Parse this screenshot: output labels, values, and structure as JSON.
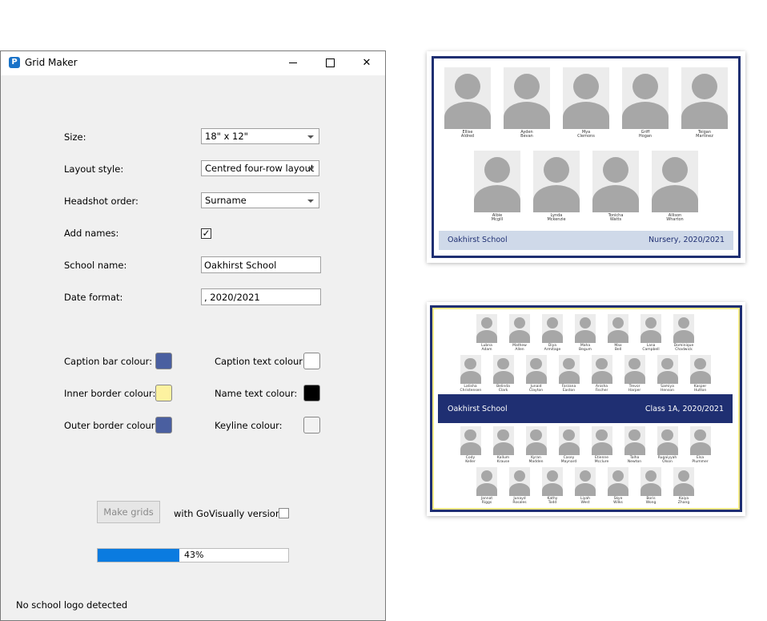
{
  "window": {
    "title": "Grid Maker",
    "app_icon": "P",
    "controls": {
      "minimize": "minimize-icon",
      "maximize": "maximize-icon",
      "close": "close-icon"
    }
  },
  "form": {
    "size_label": "Size:",
    "size_value": "18\" x 12\"",
    "layout_label": "Layout style:",
    "layout_value": "Centred four-row layout",
    "order_label": "Headshot order:",
    "order_value": "Surname",
    "names_label": "Add names:",
    "names_checked": true,
    "school_label": "School name:",
    "school_value": "Oakhirst School",
    "date_label": "Date format:",
    "date_value": ", 2020/2021",
    "check_mark": "✓"
  },
  "colours": {
    "caption_bar_label": "Caption bar colour:",
    "caption_bar": "#4a5fa0",
    "caption_text_label": "Caption text colour:",
    "caption_text": "#ffffff",
    "inner_border_label": "Inner border colour:",
    "inner_border": "#fdf2a0",
    "name_text_label": "Name text colour:",
    "name_text": "#000000",
    "outer_border_label": "Outer border colour:",
    "outer_border": "#4a5fa0",
    "keyline_label": "Keyline colour:",
    "keyline": "#f2f2f2"
  },
  "actions": {
    "make_grids": "Make grids",
    "govisually_label": "with GoVisually versions:",
    "govisually_checked": false,
    "progress": 0.43,
    "progress_text": "43%"
  },
  "status": {
    "text": "No school logo detected"
  },
  "preview1": {
    "school": "Oakhirst School",
    "class": "Nursery, 2020/2021",
    "rows": [
      [
        [
          "Ellise",
          "Aldred"
        ],
        [
          "Ayden",
          "Bevan"
        ],
        [
          "Mya",
          "Clemons"
        ],
        [
          "Griff",
          "Hogan"
        ],
        [
          "Teigan",
          "Martinez"
        ]
      ],
      [
        [
          "Albie",
          "Mcgill"
        ],
        [
          "Lynda",
          "Mckenzie"
        ],
        [
          "Tonicha",
          "Watts"
        ],
        [
          "Allison",
          "Wharton"
        ]
      ]
    ]
  },
  "preview2": {
    "school": "Oakhirst School",
    "class": "Class 1A, 2020/2021",
    "top_rows": [
      [
        [
          "Lubna",
          "Adam"
        ],
        [
          "Mathew",
          "Allen"
        ],
        [
          "Diya",
          "Armitage"
        ],
        [
          "Maha",
          "Begum"
        ],
        [
          "Max",
          "Bell"
        ],
        [
          "Lana",
          "Campbell"
        ],
        [
          "Dominique",
          "Chadwick"
        ]
      ],
      [
        [
          "Latisha",
          "Christensen"
        ],
        [
          "Belinda",
          "Clark"
        ],
        [
          "Junaid",
          "Clayton"
        ],
        [
          "Farzana",
          "Easton"
        ],
        [
          "Anisha",
          "Fischer"
        ],
        [
          "Trevor",
          "Harper"
        ],
        [
          "Samiya",
          "Henson"
        ],
        [
          "Kasper",
          "Hutton"
        ]
      ]
    ],
    "bottom_rows": [
      [
        [
          "Cody",
          "Keller"
        ],
        [
          "Kallum",
          "Krause"
        ],
        [
          "Kyran",
          "Madden"
        ],
        [
          "Casey",
          "Maynard"
        ],
        [
          "Etienne",
          "Mcclure"
        ],
        [
          "Talha",
          "Newton"
        ],
        [
          "Rugaiyyah",
          "Olson"
        ],
        [
          "Elsa",
          "Plummer"
        ]
      ],
      [
        [
          "Jannat",
          "Riggs"
        ],
        [
          "Junayd",
          "Rosales"
        ],
        [
          "Kathy",
          "Todd"
        ],
        [
          "Liyah",
          "West"
        ],
        [
          "Skye",
          "Wilks"
        ],
        [
          "Boris",
          "Wong"
        ],
        [
          "Kaiya",
          "Zhang"
        ]
      ]
    ]
  }
}
